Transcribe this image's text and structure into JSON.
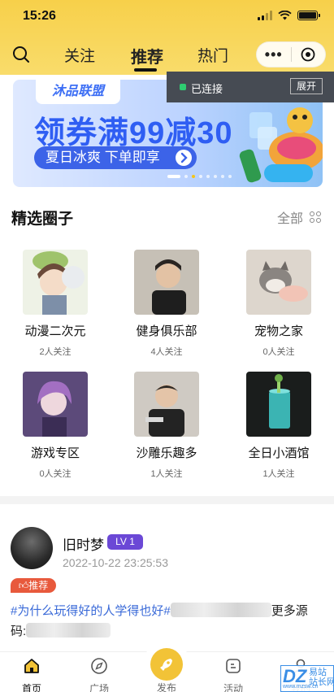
{
  "status_bar": {
    "time": "15:26"
  },
  "nav": {
    "tabs": [
      {
        "label": "关注",
        "active": false
      },
      {
        "label": "推荐",
        "active": true
      },
      {
        "label": "热门",
        "active": false
      }
    ],
    "capsule_more": "•••"
  },
  "connection": {
    "status": "已连接",
    "expand_label": "展开"
  },
  "banner": {
    "logo_text": "沐品联盟",
    "title": "领券满99减30",
    "subtitle": "夏日冰爽 下单即享",
    "page_count": 8,
    "active_index": 0
  },
  "circles": {
    "title": "精选圈子",
    "all_label": "全部",
    "items": [
      {
        "name": "动漫二次元",
        "followers": "2人关注",
        "icon": "anime-thumb"
      },
      {
        "name": "健身俱乐部",
        "followers": "4人关注",
        "icon": "fitness-thumb"
      },
      {
        "name": "宠物之家",
        "followers": "0人关注",
        "icon": "pet-thumb"
      },
      {
        "name": "游戏专区",
        "followers": "0人关注",
        "icon": "game-thumb"
      },
      {
        "name": "沙雕乐趣多",
        "followers": "1人关注",
        "icon": "funny-thumb"
      },
      {
        "name": "全日小酒馆",
        "followers": "1人关注",
        "icon": "bar-thumb"
      }
    ]
  },
  "post": {
    "username": "旧时梦",
    "level": "LV 1",
    "time": "2022-10-22 23:25:53",
    "badge": "推荐",
    "tag": "#为什么玩得好的人学得也好#",
    "text_after": "更多源",
    "text_line2": "码:"
  },
  "tabbar": {
    "items": [
      {
        "label": "首页",
        "icon": "home-icon",
        "active": true
      },
      {
        "label": "广场",
        "icon": "compass-icon",
        "active": false
      },
      {
        "label": "发布",
        "icon": "rocket-icon",
        "active": false
      },
      {
        "label": "活动",
        "icon": "activity-icon",
        "active": false
      },
      {
        "label": "我的",
        "icon": "user-icon",
        "active": false
      }
    ]
  },
  "watermark": {
    "brand": "DZ",
    "cn": "易站\n站长网",
    "url": "www.mzsw.cn"
  },
  "colors": {
    "header": "#f7d04a",
    "accent_blue": "#3a6ad8",
    "level_purple": "#6b48d6",
    "badge_red": "#e8593c"
  }
}
